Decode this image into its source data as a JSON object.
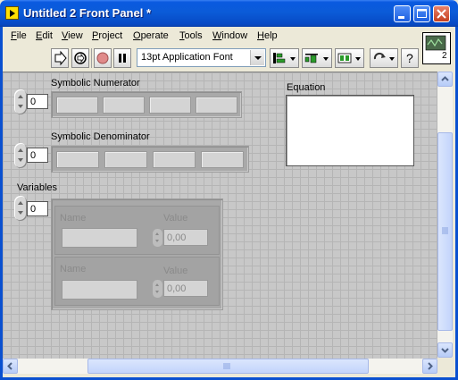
{
  "window": {
    "title": "Untitled 2 Front Panel *",
    "controls": [
      "minimize",
      "maximize",
      "close"
    ]
  },
  "menu": [
    {
      "label": "File",
      "mnemonic": "F"
    },
    {
      "label": "Edit",
      "mnemonic": "E"
    },
    {
      "label": "View",
      "mnemonic": "V"
    },
    {
      "label": "Project",
      "mnemonic": "P"
    },
    {
      "label": "Operate",
      "mnemonic": "O"
    },
    {
      "label": "Tools",
      "mnemonic": "T"
    },
    {
      "label": "Window",
      "mnemonic": "W"
    },
    {
      "label": "Help",
      "mnemonic": "H"
    }
  ],
  "toolbar": {
    "font": "13pt Application Font",
    "buttons": [
      "run-arrow-icon",
      "run-continuously-icon",
      "abort-icon",
      "pause-icon",
      "align-icon",
      "distribute-icon",
      "resize-icon",
      "reorder-icon",
      "help-icon"
    ],
    "vi_icon_number": "2"
  },
  "panel": {
    "numerator": {
      "label": "Symbolic Numerator",
      "index": "0"
    },
    "denominator": {
      "label": "Symbolic Denominator",
      "index": "0"
    },
    "variables": {
      "label": "Variables",
      "index": "0",
      "name_label": "Name",
      "value_label": "Value",
      "rows": [
        {
          "value": "0,00"
        },
        {
          "value": "0,00"
        }
      ]
    },
    "equation": {
      "label": "Equation"
    }
  },
  "colors": {
    "titlebar": "#0a5ae0",
    "panel_grid": "#c8c8c8",
    "close_button": "#c5401f"
  }
}
